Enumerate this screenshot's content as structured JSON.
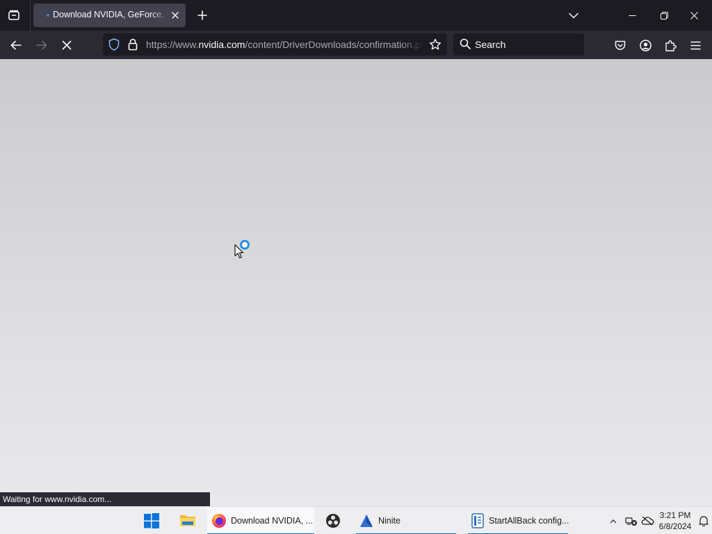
{
  "browser": {
    "tab": {
      "title": "Download NVIDIA, GeForce, Quadro, and Tesla Drivers",
      "close_icon": "close-icon",
      "loading_indicator_color": "#3d7ddb"
    },
    "toolbar": {
      "url_prefix": "https://www.",
      "url_domain": "nvidia.com",
      "url_path": "/content/DriverDownloads/confirmation.php",
      "search_label": "Search"
    },
    "icons": {
      "list_all_tabs": "tab-list-icon",
      "new_tab": "plus-icon",
      "tab_overflow": "chevron-down-icon",
      "back": "arrow-left-icon",
      "forward": "arrow-right-icon",
      "stop": "close-icon",
      "tracking_protection": "shield-icon",
      "site_security": "lock-icon",
      "bookmark": "star-icon",
      "pocket": "pocket-icon",
      "account": "account-icon",
      "extensions": "puzzle-icon",
      "menu": "hamburger-icon"
    },
    "status_text": "Waiting for www.nvidia.com..."
  },
  "taskbar": {
    "tasks": [
      {
        "label": "Download NVIDIA, ...",
        "icon": "firefox-icon",
        "active": true
      },
      {
        "label": "",
        "icon": "obs-icon",
        "active": false
      },
      {
        "label": "Ninite",
        "icon": "ninite-icon",
        "active": false
      },
      {
        "label": "StartAllBack config...",
        "icon": "startallback-icon",
        "active": false
      }
    ],
    "clock": {
      "time": "3:21 PM",
      "date": "6/8/2024"
    },
    "accent_color": "#0067c0"
  }
}
